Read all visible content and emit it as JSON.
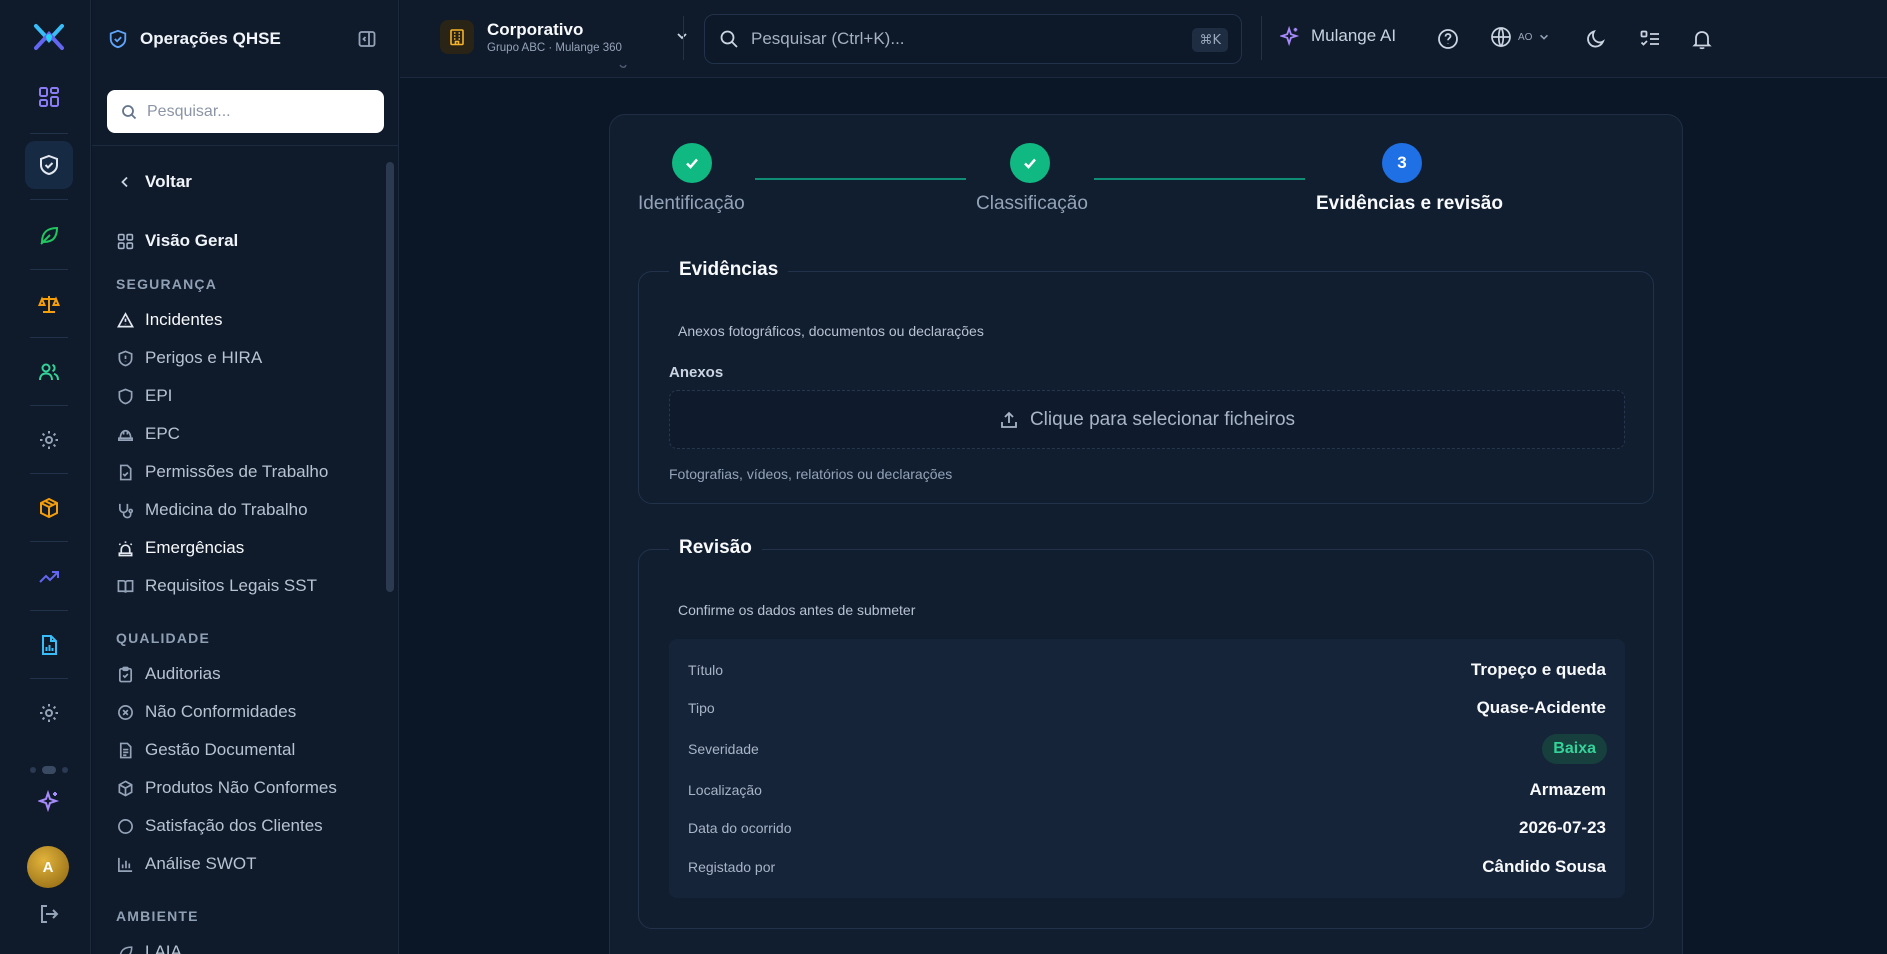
{
  "app": {
    "module_title": "Operações QHSE"
  },
  "sidebar": {
    "search_placeholder": "Pesquisar...",
    "back_label": "Voltar",
    "overview_label": "Visão Geral",
    "sections": {
      "security": "SEGURANÇA",
      "quality": "QUALIDADE",
      "environment": "AMBIENTE"
    },
    "security_items": [
      {
        "label": "Incidentes",
        "icon": "alert-triangle-icon"
      },
      {
        "label": "Perigos e HIRA",
        "icon": "shield-alert-icon"
      },
      {
        "label": "EPI",
        "icon": "shield-icon"
      },
      {
        "label": "EPC",
        "icon": "hard-hat-icon"
      },
      {
        "label": "Permissões de Trabalho",
        "icon": "file-check-icon"
      },
      {
        "label": "Medicina do Trabalho",
        "icon": "stethoscope-icon"
      },
      {
        "label": "Emergências",
        "icon": "siren-icon"
      },
      {
        "label": "Requisitos Legais SST",
        "icon": "book-open-icon"
      }
    ],
    "quality_items": [
      {
        "label": "Auditorias",
        "icon": "clipboard-check-icon"
      },
      {
        "label": "Não Conformidades",
        "icon": "x-circle-icon"
      },
      {
        "label": "Gestão Documental",
        "icon": "file-text-icon"
      },
      {
        "label": "Produtos Não Conformes",
        "icon": "package-icon"
      },
      {
        "label": "Satisfação dos Clientes",
        "icon": "circle-icon"
      },
      {
        "label": "Análise SWOT",
        "icon": "bar-chart-icon"
      }
    ],
    "environment_items": [
      {
        "label": "LAIA",
        "icon": "leaf-icon"
      }
    ]
  },
  "rail": {
    "avatar_initial": "A"
  },
  "topbar": {
    "org_name": "Corporativo",
    "org_subtitle": "Grupo ABC · Mulange 360",
    "search_placeholder": "Pesquisar (Ctrl+K)...",
    "search_shortcut": "⌘K",
    "ai_label": "Mulange AI",
    "language_code": "AO"
  },
  "wizard": {
    "steps": [
      {
        "label": "Identificação",
        "status": "done",
        "marker": "✓"
      },
      {
        "label": "Classificação",
        "status": "done",
        "marker": "✓"
      },
      {
        "label": "Evidências e revisão",
        "status": "current",
        "marker": "3"
      }
    ],
    "evidence": {
      "title": "Evidências",
      "description": "Anexos fotográficos, documentos ou declarações",
      "attachments_label": "Anexos",
      "dropzone_text": "Clique para selecionar ficheiros",
      "hint": "Fotografias, vídeos, relatórios ou declarações"
    },
    "review": {
      "title": "Revisão",
      "description": "Confirme os dados antes de submeter",
      "rows": [
        {
          "label": "Título",
          "value": "Tropeço e queda"
        },
        {
          "label": "Tipo",
          "value": "Quase-Acidente"
        },
        {
          "label": "Severidade",
          "value": "Baixa"
        },
        {
          "label": "Localização",
          "value": "Armazem"
        },
        {
          "label": "Data do ocorrido",
          "value": "2026-07-23"
        },
        {
          "label": "Registado por",
          "value": "Cândido Sousa"
        }
      ]
    }
  },
  "colors": {
    "accent_blue": "#1f6fe5",
    "success_green": "#10b981",
    "badge_green_text": "#34d399",
    "background": "#0b1727"
  }
}
